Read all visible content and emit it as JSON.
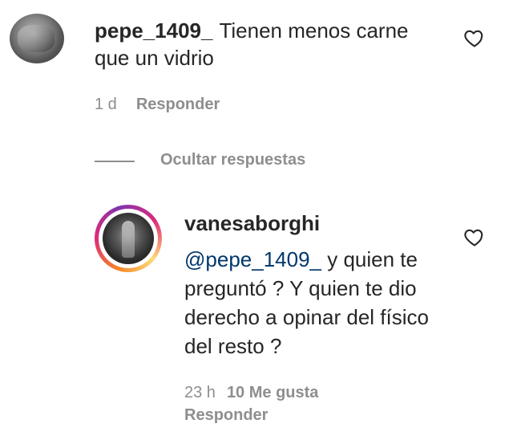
{
  "comment": {
    "username": "pepe_1409_",
    "text": "Tienen menos carne que un vidrio",
    "time": "1 d",
    "reply_label": "Responder"
  },
  "hide_replies_label": "Ocultar respuestas",
  "reply": {
    "username": "vanesaborghi",
    "mention": "@pepe_1409_",
    "text": " y quien te preguntó ? Y quien te dio derecho a opinar del físico del resto ?",
    "time": "23 h",
    "likes": "10 Me gusta",
    "reply_label": "Responder"
  },
  "icons": {
    "like": "heart-outline-icon"
  },
  "colors": {
    "text": "#262626",
    "secondary": "#8e8e8e",
    "mention": "#00376b"
  }
}
